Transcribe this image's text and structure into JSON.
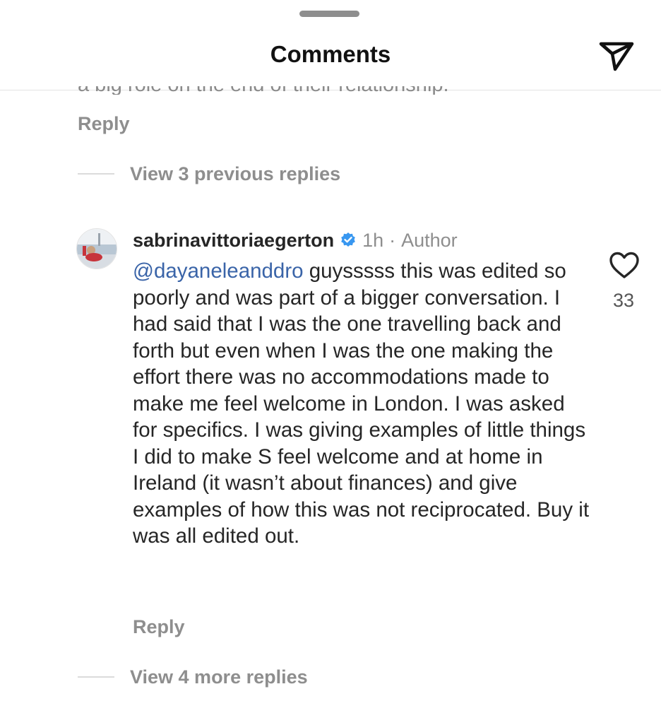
{
  "header": {
    "title": "Comments"
  },
  "previous_comment": {
    "truncated_text": "a big role on the end of their relationship.",
    "reply_label": "Reply",
    "view_replies_label": "View 3 previous replies"
  },
  "comment": {
    "username": "sabrinavittoriaegerton",
    "verified": true,
    "time": "1h",
    "separator": "·",
    "author_tag": "Author",
    "mention": "@dayaneleanddro",
    "text": " guysssss this was edited so poorly and was part of a bigger conversation. I had said that I was the one travelling back and forth but even when I was the one making the effort there was no accommodations made to make me feel welcome in London. I was asked for specifics. I was giving examples of little things I did to make S feel welcome and at home in Ireland (it wasn’t about finances) and give examples of how this was not reciprocated. Buy it was all edited out.",
    "like_count": "33",
    "reply_label": "Reply",
    "view_more_label": "View 4 more replies"
  },
  "icons": {
    "share": "paper-plane-icon",
    "like": "heart-outline-icon",
    "verified": "verified-badge-icon"
  },
  "colors": {
    "mention": "#3a64a8",
    "verified": "#3897f0",
    "muted": "#8e8e8e"
  }
}
